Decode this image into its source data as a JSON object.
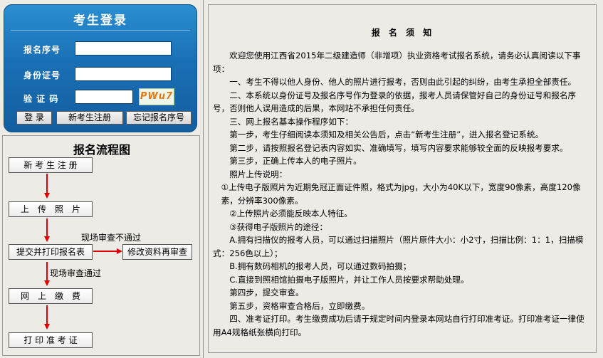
{
  "login": {
    "title": "考生登录",
    "fields": [
      {
        "label": "报名序号",
        "value": "",
        "placeholder": ""
      },
      {
        "label": "身份证号",
        "value": "",
        "placeholder": ""
      },
      {
        "label": "验 证 码",
        "value": "",
        "placeholder": ""
      }
    ],
    "captcha_text": "PWu7",
    "buttons": {
      "login": "登 录",
      "register": "新考生注册",
      "forgot": "忘记报名序号"
    }
  },
  "flow": {
    "title": "报名流程图",
    "steps": [
      "新 考 生 注 册",
      "上　传　照　片",
      "提交并打印报名表",
      "修改资料再审查",
      "网　上　缴　费",
      "打 印 准 考 证"
    ],
    "note_fail": "现场审查不通过",
    "note_pass": "现场审查通过",
    "arrow_color": "#e00000"
  },
  "notice": {
    "title": "报 名 须 知",
    "paragraphs": [
      "欢迎您使用江西省2015年二级建造师（非增项）执业资格考试报名系统，请务必认真阅读以下事项：",
      "一、考生不得以他人身份、他人的照片进行报考，否则由此引起的纠纷，由考生承担全部责任。",
      "二、本系统以身份证号及报名序号作为登录的依据，报考人员请保管好自己的身份证号和报名序号，否则他人误用造成的后果，本网站不承担任何责任。",
      "三、网上报名基本操作程序如下：",
      "第一步，考生仔细阅读本须知及相关公告后，点击“新考生注册”，进入报名登记系统。",
      "第二步，请按照报名登记表内容如实、准确填写，填写内容要求能够较全面的反映报考要求。",
      "第三步，正确上传本人的电子照片。",
      "照片上传说明：",
      "①上传电子版照片为近期免冠正面证件照，格式为jpg，大小为40K以下，宽度90像素，高度120像素，分辨率300像素。",
      "②上传照片必须能反映本人特征。",
      "③获得电子版照片的途径：",
      "A.拥有扫描仪的报考人员，可以通过扫描照片（照片原件大小：小2寸，扫描比例：1：1，扫描模式：256色以上）；",
      "B.拥有数码相机的报考人员，可以通过数码拍摄；",
      "C.直接到照相馆拍摄电子版照片，并让工作人员按要求帮助处理。",
      "第四步，提交审查。",
      "第五步，资格审查合格后，立即缴费。",
      "四、准考证打印。考生缴费成功后请于规定时间内登录本网站自行打印准考证。打印准考证一律使用A4规格纸张横向打印。"
    ]
  }
}
